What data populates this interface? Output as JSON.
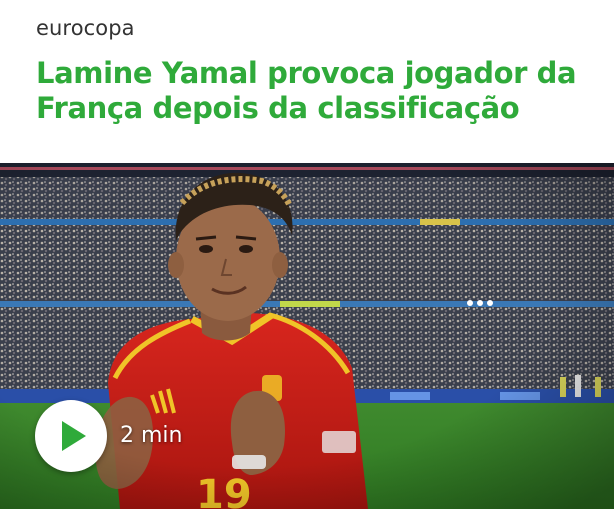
{
  "article": {
    "section": "eurocopa",
    "headline": "Lamine Yamal provoca jogador da França depois da classificação",
    "video": {
      "duration": "2 min",
      "thumbnail_icon": "video-thumbnail-player-celebrating",
      "play_icon": "play-icon"
    }
  },
  "colors": {
    "accent": "#2faa3a",
    "section_text": "#333333",
    "background": "#ffffff"
  }
}
